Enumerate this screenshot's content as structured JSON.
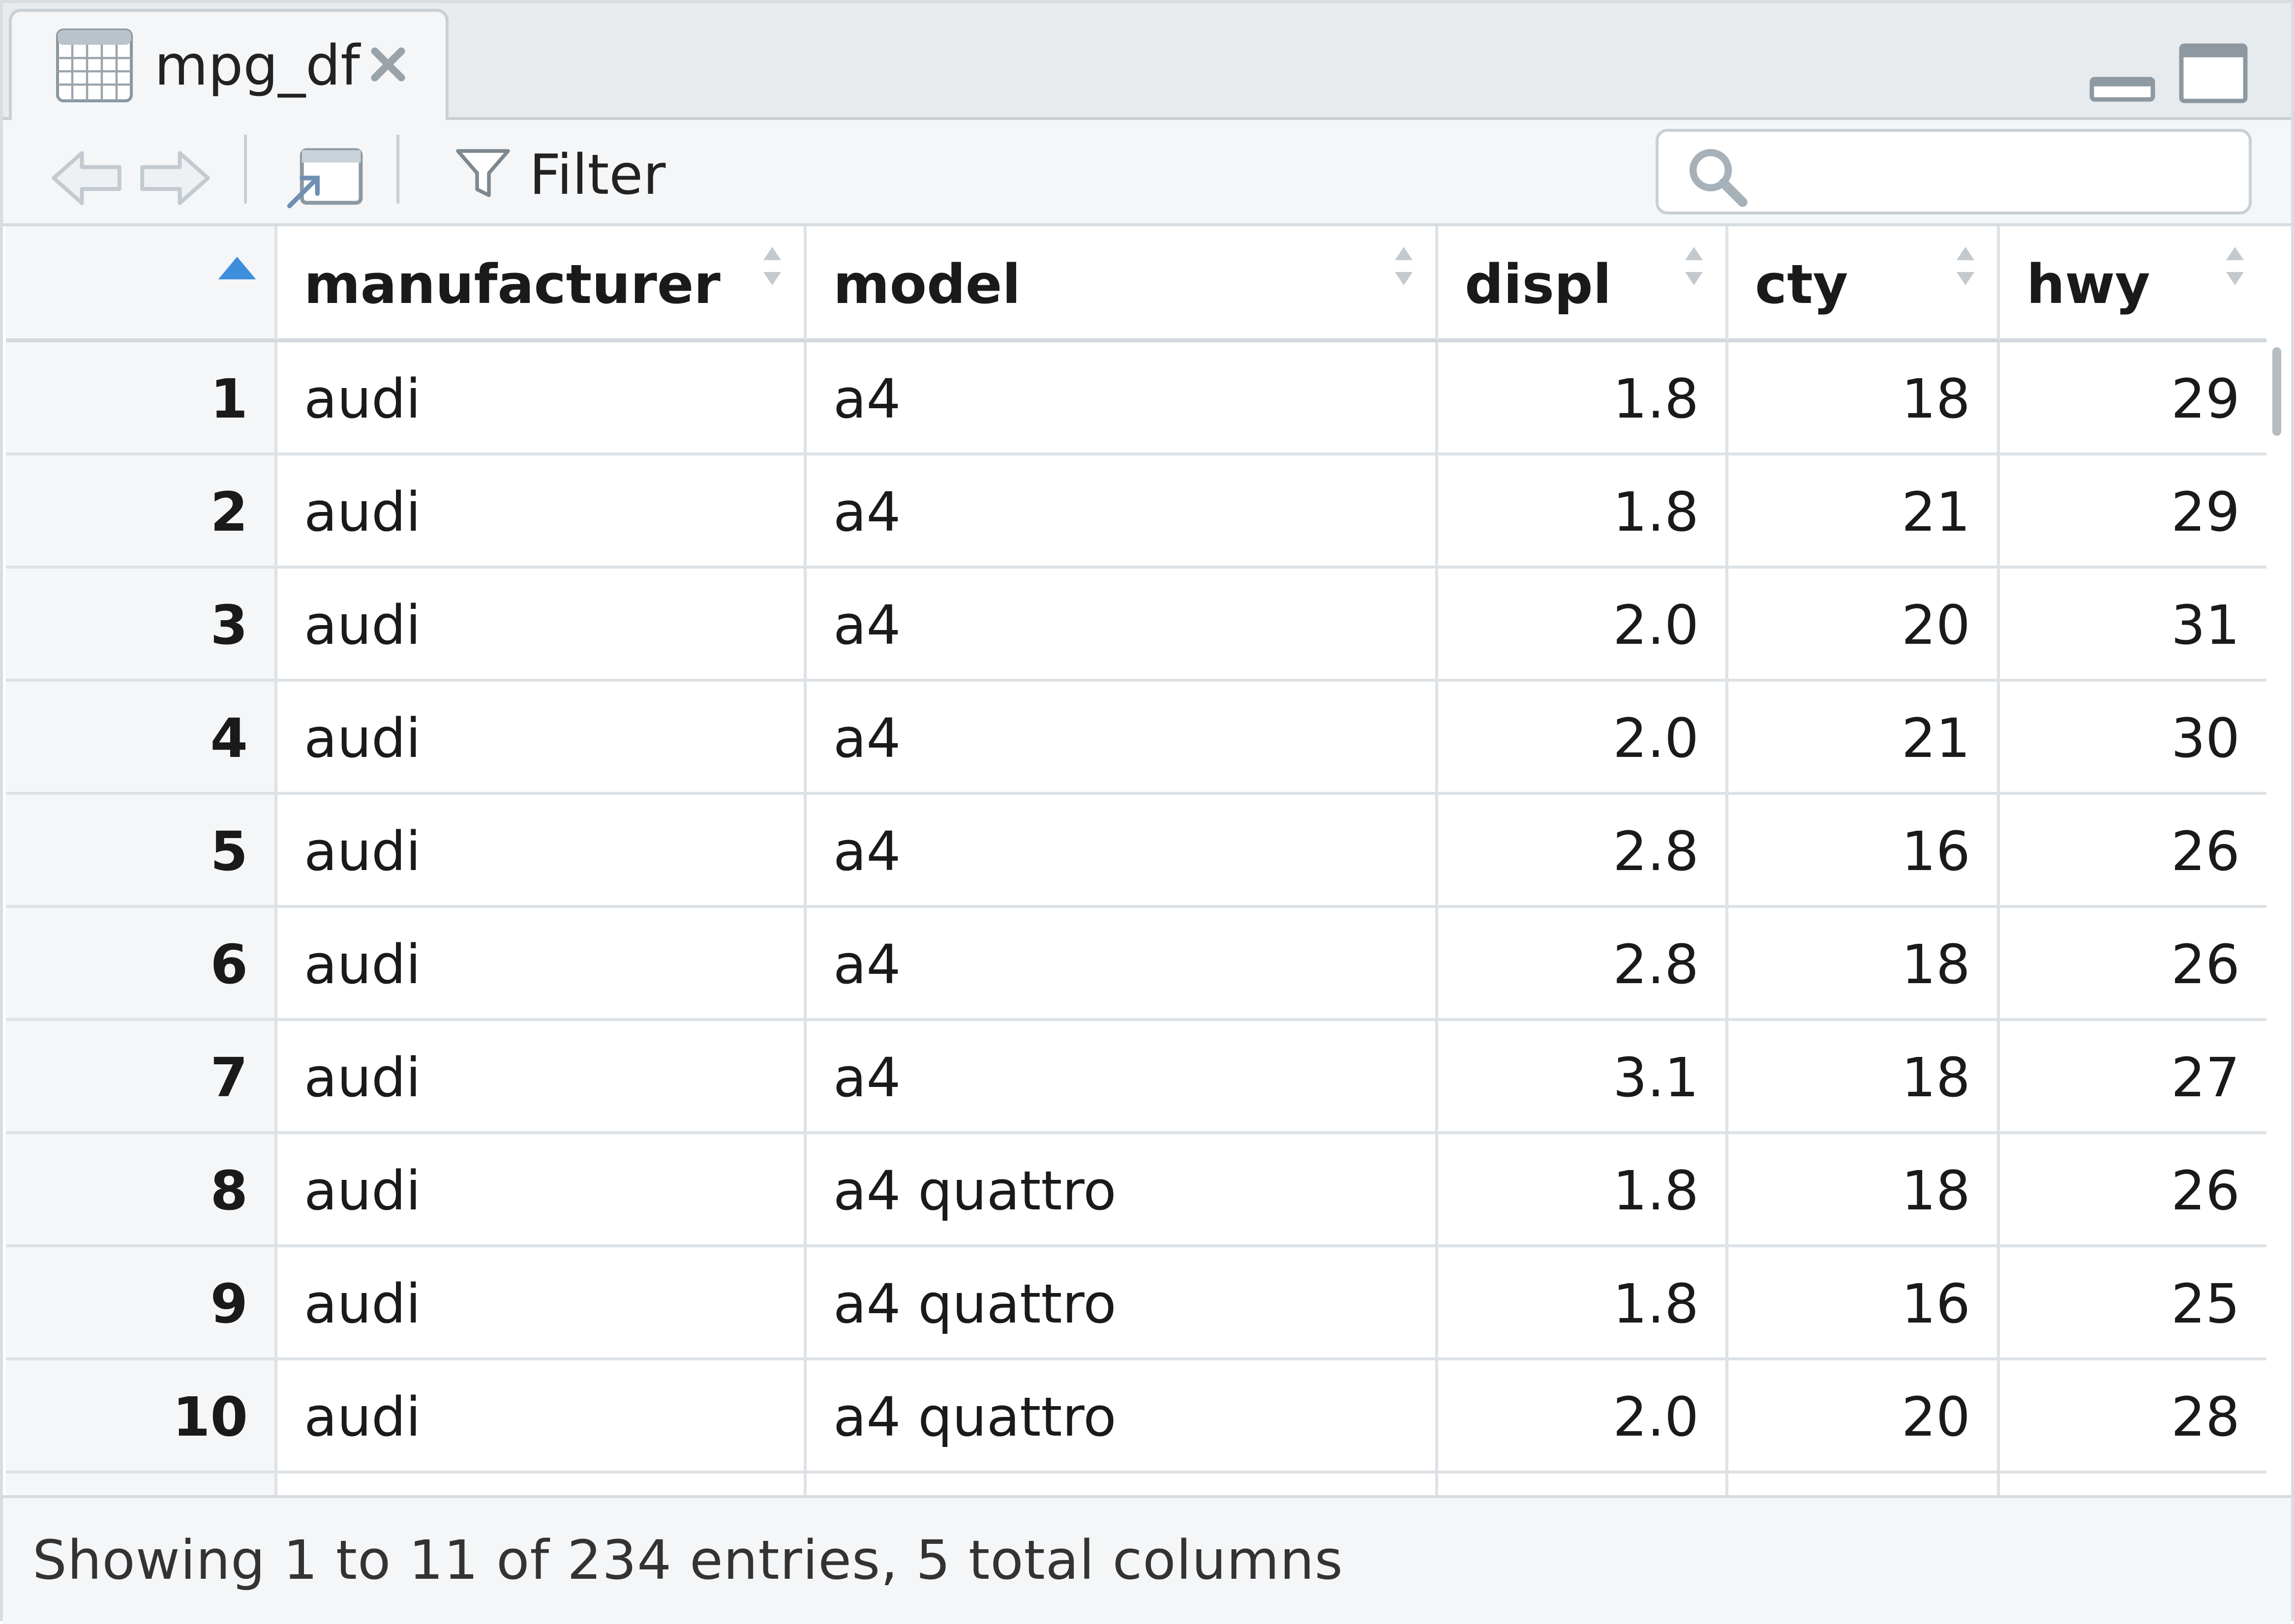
{
  "tab": {
    "title": "mpg_df"
  },
  "toolbar": {
    "filter_label": "Filter",
    "search_placeholder": ""
  },
  "columns": [
    {
      "label": "",
      "sort": "asc"
    },
    {
      "label": "manufacturer"
    },
    {
      "label": "model"
    },
    {
      "label": "displ"
    },
    {
      "label": "cty"
    },
    {
      "label": "hwy"
    }
  ],
  "rows": [
    [
      "1",
      "audi",
      "a4",
      "1.8",
      "18",
      "29"
    ],
    [
      "2",
      "audi",
      "a4",
      "1.8",
      "21",
      "29"
    ],
    [
      "3",
      "audi",
      "a4",
      "2.0",
      "20",
      "31"
    ],
    [
      "4",
      "audi",
      "a4",
      "2.0",
      "21",
      "30"
    ],
    [
      "5",
      "audi",
      "a4",
      "2.8",
      "16",
      "26"
    ],
    [
      "6",
      "audi",
      "a4",
      "2.8",
      "18",
      "26"
    ],
    [
      "7",
      "audi",
      "a4",
      "3.1",
      "18",
      "27"
    ],
    [
      "8",
      "audi",
      "a4 quattro",
      "1.8",
      "18",
      "26"
    ],
    [
      "9",
      "audi",
      "a4 quattro",
      "1.8",
      "16",
      "25"
    ],
    [
      "10",
      "audi",
      "a4 quattro",
      "2.0",
      "20",
      "28"
    ],
    [
      "",
      "",
      "",
      "",
      "",
      ""
    ]
  ],
  "footer": {
    "status": "Showing 1 to 11 of 234 entries, 5 total columns"
  },
  "colors": {
    "sort_active": "#3d8fdc",
    "sort_inactive": "#c4c9cd",
    "header_bg": "#f4f6f8"
  }
}
